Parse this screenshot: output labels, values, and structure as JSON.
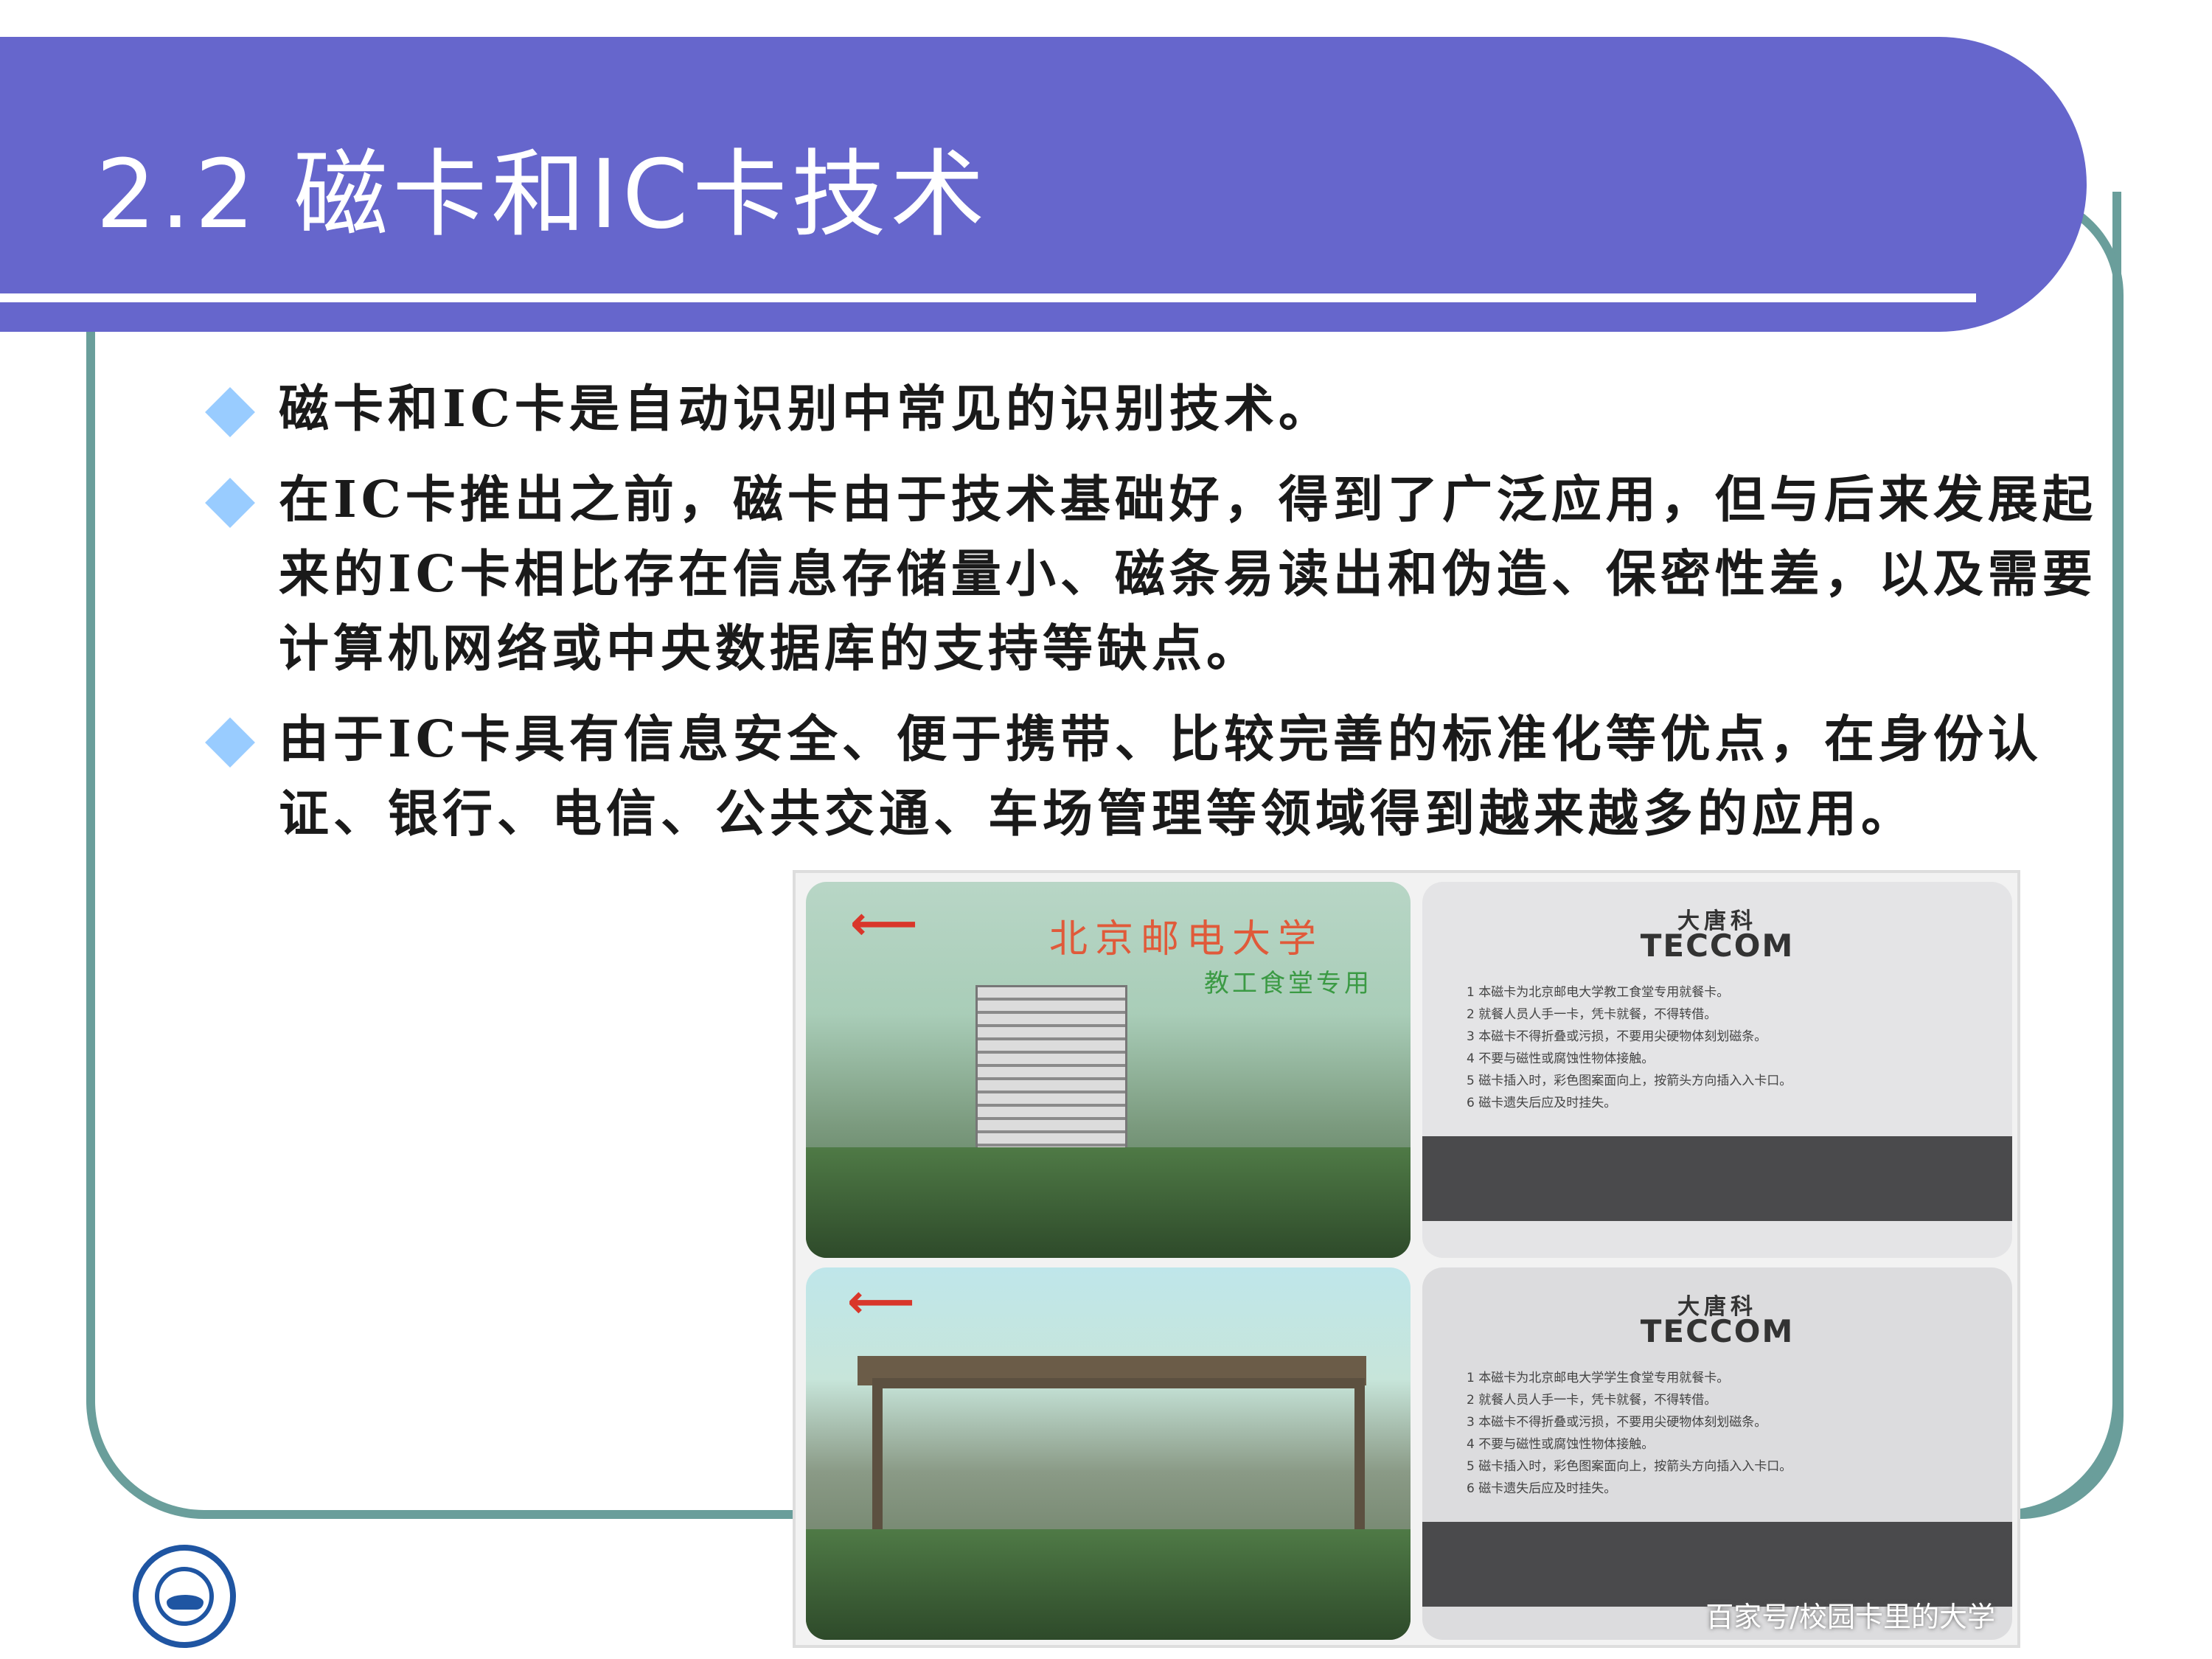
{
  "slide": {
    "title": "2.2 磁卡和IC卡技术",
    "bullets": [
      {
        "text": "磁卡和IC卡是自动识别中常见的识别技术。"
      },
      {
        "text": "在IC卡推出之前，磁卡由于技术基础好，得到了广泛应用，但与后来发展起来的IC卡相比存在信息存储量小、磁条易读出和伪造、保密性差，以及需要计算机网络或中央数据库的支持等缺点。"
      },
      {
        "text": "由于IC卡具有信息安全、便于携带、比较完善的标准化等优点，在身份认证、银行、电信、公共交通、车场管理等领域得到越来越多的应用。"
      }
    ]
  },
  "photo": {
    "card1_title": "北京邮电大学",
    "card1_subtitle": "教工食堂专用",
    "brand_cn": "大唐科",
    "brand_en": "TECCOM",
    "back1_rules": [
      "1 本磁卡为北京邮电大学教工食堂专用就餐卡。",
      "2 就餐人员人手一卡，凭卡就餐，不得转借。",
      "3 本磁卡不得折叠或污损，不要用尖硬物体刻划磁条。",
      "4 不要与磁性或腐蚀性物体接触。",
      "5 磁卡插入时，彩色图案面向上，按箭头方向插入入卡口。",
      "6 磁卡遗失后应及时挂失。"
    ],
    "back2_rules": [
      "1 本磁卡为北京邮电大学学生食堂专用就餐卡。",
      "2 就餐人员人手一卡，凭卡就餐，不得转借。",
      "3 本磁卡不得折叠或污损，不要用尖硬物体刻划磁条。",
      "4 不要与磁性或腐蚀性物体接触。",
      "5 磁卡插入时，彩色图案面向上，按箭头方向插入入卡口。",
      "6 磁卡遗失后应及时挂失。"
    ],
    "watermark": "百家号/校园卡里的大学"
  },
  "icons": {
    "bullet": "diamond-bullet-icon",
    "arrow": "left-arrow-icon",
    "logo": "university-seal-icon"
  },
  "colors": {
    "title_bar": "#6666cc",
    "frame": "#6a9e9b",
    "bullet": "#99ccff"
  }
}
